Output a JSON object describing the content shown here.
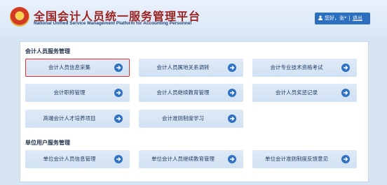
{
  "header": {
    "title": "全国会计人员统一服务管理平台",
    "subtitle": "National Unified Service Management Platform for Accounting Personnel",
    "user_greeting": "您好，张*",
    "separator": "|",
    "logout_label": "退出"
  },
  "sections": [
    {
      "title": "会计人员服务管理",
      "tiles": [
        {
          "label": "会计人员信息采集",
          "selected": true
        },
        {
          "label": "会计人员属地关系调转"
        },
        {
          "label": "会计专业技术资格考试"
        },
        {
          "label": "会计职称管理"
        },
        {
          "label": "会计人员继续教育管理"
        },
        {
          "label": "会计人员奖惩记录"
        },
        {
          "label": "高端会计人才培养项目"
        },
        {
          "label": "会计准则制度学习"
        }
      ]
    },
    {
      "title": "单位用户服务管理",
      "tiles": [
        {
          "label": "单位会计人员信息管理"
        },
        {
          "label": "单位会计人员继续教育管理"
        },
        {
          "label": "单位会计准则制度反馈意见"
        }
      ]
    }
  ],
  "colors": {
    "accent": "#2f72c4",
    "title_red": "#9b2220",
    "selection_outline": "#e0322d"
  }
}
